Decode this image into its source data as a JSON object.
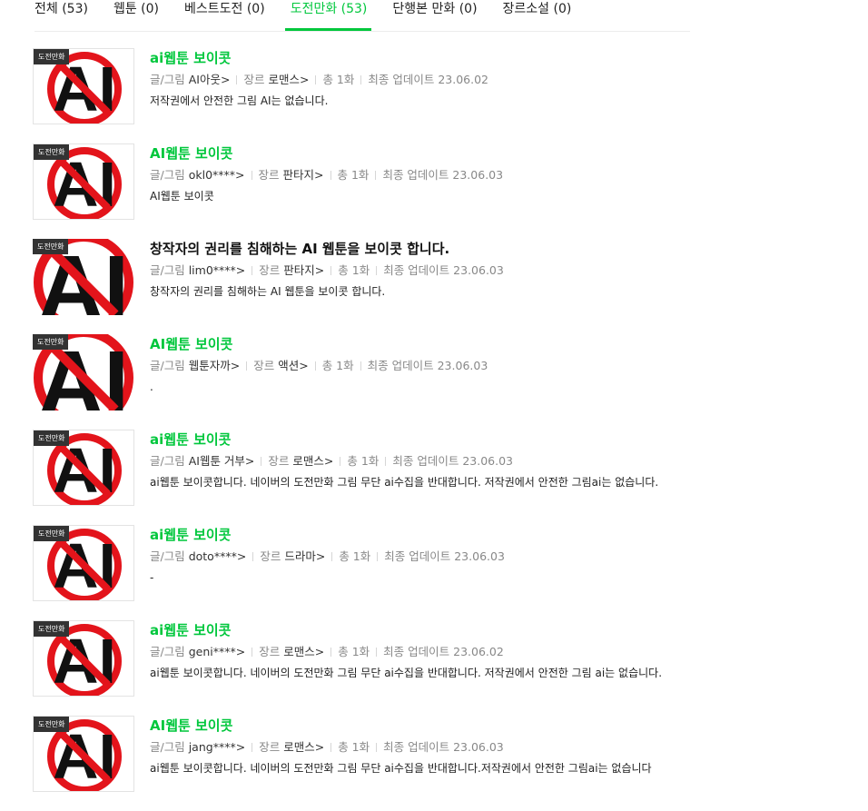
{
  "tabs": [
    {
      "label": "전체 (53)",
      "active": false
    },
    {
      "label": "웹툰 (0)",
      "active": false
    },
    {
      "label": "베스트도전 (0)",
      "active": false
    },
    {
      "label": "도전만화 (53)",
      "active": true
    },
    {
      "label": "단행본 만화 (0)",
      "active": false
    },
    {
      "label": "장르소설 (0)",
      "active": false
    }
  ],
  "labels": {
    "badge": "도전만화",
    "author_prefix": "글/그림",
    "genre_prefix": "장르",
    "update_prefix": "최종 업데이트",
    "arrow": ">"
  },
  "items": [
    {
      "title": "ai웹툰 보이콧",
      "author": "AI아웃",
      "genre": "로맨스",
      "episodes": "총 1화",
      "updated": "23.06.02",
      "desc": "저작권에서 안전한 그림 AI는 없습니다."
    },
    {
      "title": "AI웹툰 보이콧",
      "author": "okl0****",
      "genre": "판타지",
      "episodes": "총 1화",
      "updated": "23.06.03",
      "desc": "AI웹툰 보이콧"
    },
    {
      "title": "창작자의 권리를 침해하는 AI 웹툰을 보이콧 합니다.",
      "author": "lim0****",
      "genre": "판타지",
      "episodes": "총 1화",
      "updated": "23.06.03",
      "desc": "창작자의 권리를 침해하는 AI 웹툰을 보이콧 합니다."
    },
    {
      "title": "AI웹툰 보이콧",
      "author": "웹툰자까",
      "genre": "액션",
      "episodes": "총 1화",
      "updated": "23.06.03",
      "desc": "."
    },
    {
      "title": "ai웹툰 보이콧",
      "author": "AI웹툰 거부",
      "genre": "로맨스",
      "episodes": "총 1화",
      "updated": "23.06.03",
      "desc": "ai웹툰 보이콧합니다. 네이버의 도전만화 그림 무단 ai수집을 반대합니다. 저작권에서 안전한 그림ai는 없습니다."
    },
    {
      "title": "ai웹툰 보이콧",
      "author": "doto****",
      "genre": "드라마",
      "episodes": "총 1화",
      "updated": "23.06.03",
      "desc": "-"
    },
    {
      "title": "ai웹툰 보이콧",
      "author": "geni****",
      "genre": "로맨스",
      "episodes": "총 1화",
      "updated": "23.06.02",
      "desc": "ai웹툰 보이콧합니다. 네이버의 도전만화 그림 무단 ai수집을 반대합니다. 저작권에서 안전한 그림 ai는 없습니다."
    },
    {
      "title": "AI웹툰 보이콧",
      "author": "jang****",
      "genre": "로맨스",
      "episodes": "총 1화",
      "updated": "23.06.03",
      "desc": "ai웹툰 보이콧합니다. 네이버의 도전만화 그림 무단 ai수집을 반대합니다.저작권에서 안전한 그림ai는 없습니다"
    }
  ],
  "colors": {
    "accent": "#00c73c",
    "prohibit_red": "#e3141b"
  },
  "icons": {
    "thumbnail": "no-ai-icon"
  }
}
